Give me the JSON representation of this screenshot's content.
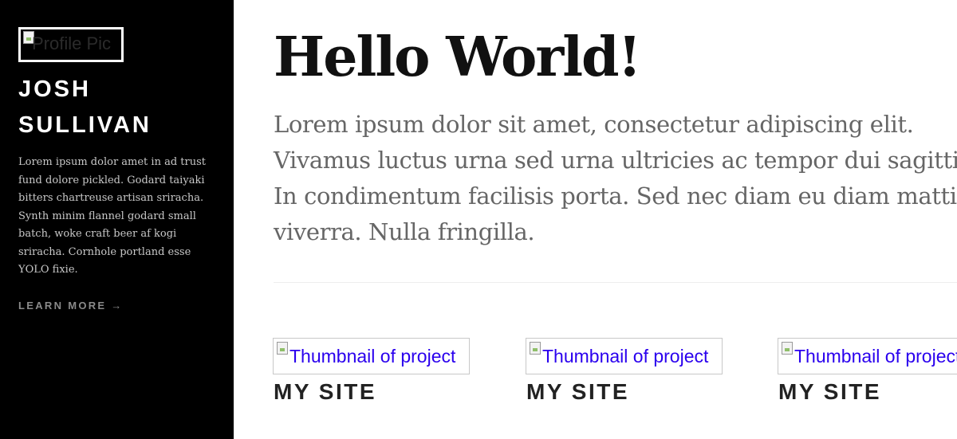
{
  "sidebar": {
    "profile_pic_alt": "Profile Pic",
    "name_line1": "JOSH",
    "name_line2": "SULLIVAN",
    "bio": "Lorem ipsum dolor amet in ad trust fund dolore pickled. Godard taiyaki bitters chartreuse artisan sriracha. Synth minim flannel godard small batch, woke craft beer af kogi sriracha. Cornhole portland esse YOLO fixie.",
    "learn_more": "LEARN MORE →"
  },
  "main": {
    "title": "Hello World!",
    "paragraph": "Lorem ipsum dolor sit amet, consectetur adipiscing elit. Vivamus luctus urna sed urna ultricies ac tempor dui sagittis. In condimentum facilisis porta. Sed nec diam eu diam mattis viverra. Nulla fringilla."
  },
  "projects": [
    {
      "thumb_alt": "Thumbnail of project",
      "title": "MY SITE"
    },
    {
      "thumb_alt": "Thumbnail of project",
      "title": "MY SITE"
    },
    {
      "thumb_alt": "Thumbnail of project",
      "title": "MY SITE"
    }
  ],
  "colors": {
    "sidebar_bg": "#000000",
    "link_blue": "#2a00ee",
    "body_text": "#666666",
    "heading": "#111111"
  },
  "icons": {
    "broken_image": "broken-image-icon"
  }
}
